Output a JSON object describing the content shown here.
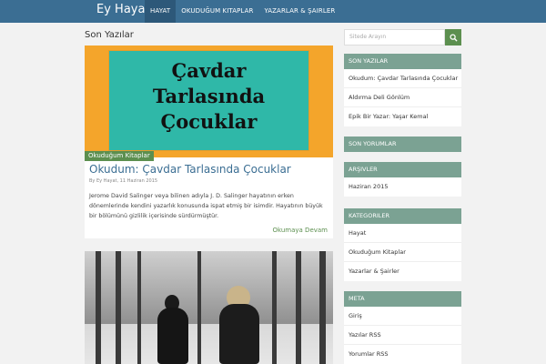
{
  "header": {
    "brand": "Ey Hayat",
    "nav": [
      "Hayat",
      "Okuduğum Kitaplar",
      "Yazarlar & Şairler"
    ]
  },
  "main": {
    "page_title": "Son Yazılar",
    "post1": {
      "image_text": [
        "Çavdar",
        "Tarlasında",
        "Çocuklar"
      ],
      "category": "Okuduğum Kitaplar",
      "title": "Okudum: Çavdar Tarlasında Çocuklar",
      "meta": "By Ey Hayat, 11 Haziran 2015",
      "excerpt": "Jerome David Salinger veya bilinen adıyla J. D. Salinger hayatının erken dönemlerinde kendini yazarlık konusunda ispat etmiş bir isimdir. Hayatının büyük bir bölümünü gizlilik içerisinde sürdürmüştür.",
      "read_more": "Okumaya Devam"
    }
  },
  "sidebar": {
    "search_placeholder": "Sitede Arayın",
    "widgets": [
      {
        "title": "Son Yazılar",
        "items": [
          "Okudum: Çavdar Tarlasında Çocuklar",
          "Aldırma Deli Gönlüm",
          "Epik Bir Yazar: Yaşar Kemal"
        ]
      },
      {
        "title": "Son Yorumlar",
        "items": []
      },
      {
        "title": "Arşivler",
        "items": [
          "Haziran 2015"
        ]
      },
      {
        "title": "Kategoriler",
        "items": [
          "Hayat",
          "Okuduğum Kitaplar",
          "Yazarlar & Şairler"
        ]
      },
      {
        "title": "Meta",
        "items": [
          "Giriş",
          "Yazılar RSS",
          "Yorumlar RSS"
        ]
      }
    ]
  },
  "colors": {
    "topbar": "#3b6e93",
    "accent_green": "#5c8f4f",
    "widget_head": "#7ba293"
  }
}
